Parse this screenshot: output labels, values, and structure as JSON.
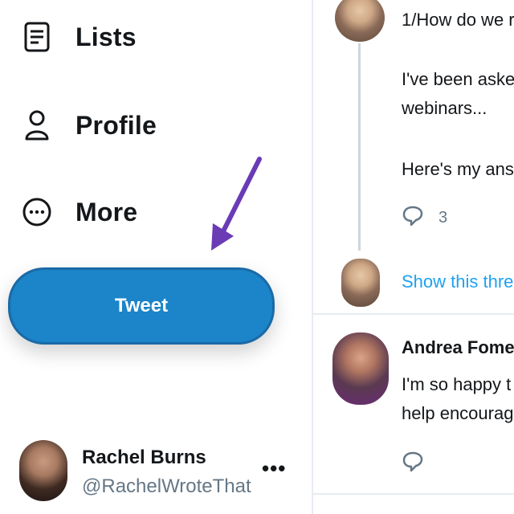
{
  "sidebar": {
    "nav": [
      {
        "label": "Lists",
        "icon": "list-icon"
      },
      {
        "label": "Profile",
        "icon": "person-icon"
      },
      {
        "label": "More",
        "icon": "more-circle-icon"
      }
    ],
    "tweet_button": "Tweet",
    "account": {
      "name": "Rachel Burns",
      "handle": "@RachelWroteThat",
      "more": "•••"
    }
  },
  "feed": {
    "tweet1": {
      "line1": "1/How do we r",
      "line2": "I've been aske",
      "line3": "webinars...",
      "line4": "Here's my ans",
      "reply_count": "3"
    },
    "show_thread": "Show this thre",
    "tweet2": {
      "author": "Andrea Fome",
      "line1": "I'm so happy t",
      "line2": "help encourag"
    }
  },
  "colors": {
    "accent": "#1c84c8",
    "link": "#1da1f2",
    "arrow": "#6a3bb5"
  }
}
